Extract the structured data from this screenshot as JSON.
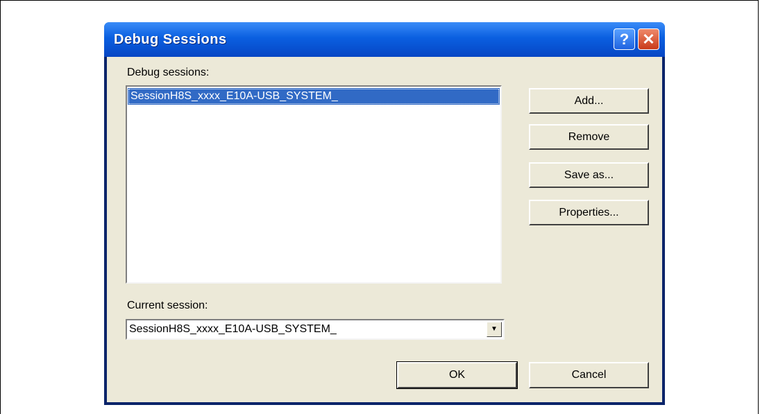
{
  "dialog": {
    "title": "Debug Sessions",
    "help_icon": "?",
    "close_icon": "✕"
  },
  "sessions": {
    "label": "Debug sessions:",
    "items": [
      "SessionH8S_xxxx_E10A-USB_SYSTEM_"
    ]
  },
  "buttons": {
    "add": "Add...",
    "remove": "Remove",
    "save_as": "Save as...",
    "properties": "Properties...",
    "ok": "OK",
    "cancel": "Cancel"
  },
  "current": {
    "label": "Current session:",
    "value": "SessionH8S_xxxx_E10A-USB_SYSTEM_",
    "arrow_icon": "▼"
  },
  "colors": {
    "title_bar": "#0a5fe0",
    "selection": "#316ac5",
    "client": "#ece9d8"
  }
}
